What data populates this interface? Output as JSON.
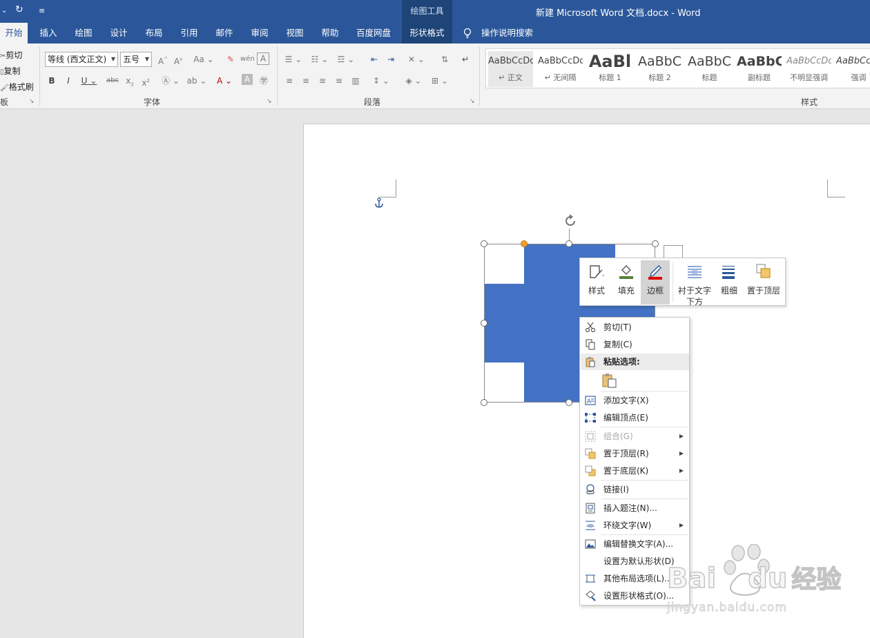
{
  "titlebar": {
    "context_group": "绘图工具",
    "document_title": "新建 Microsoft Word 文档.docx  -  Word"
  },
  "tabs": [
    "开始",
    "插入",
    "绘图",
    "设计",
    "布局",
    "引用",
    "邮件",
    "审阅",
    "视图",
    "帮助",
    "百度网盘",
    "形状格式"
  ],
  "search": {
    "label": "操作说明搜索"
  },
  "clipboard": {
    "cut": "剪切",
    "copy": "复制",
    "format_painter": "格式刷",
    "group_label": "板"
  },
  "font": {
    "name": "等线 (西文正文)",
    "size": "五号",
    "group_label": "字体"
  },
  "paragraph": {
    "group_label": "段落"
  },
  "styles": {
    "group_label": "样式",
    "items": [
      {
        "sample": "AaBbCcDd",
        "name": "↵ 正文"
      },
      {
        "sample": "AaBbCcDd",
        "name": "↵ 无间隔"
      },
      {
        "sample": "AaBl",
        "name": "标题 1"
      },
      {
        "sample": "AaBbC",
        "name": "标题 2"
      },
      {
        "sample": "AaBbC",
        "name": "标题"
      },
      {
        "sample": "AaBbC",
        "name": "副标题"
      },
      {
        "sample": "AaBbCcDd",
        "name": "不明显强调"
      },
      {
        "sample": "AaBbCcDd",
        "name": "强调"
      }
    ]
  },
  "mini_toolbar": {
    "buttons": [
      {
        "label": "样式",
        "icon": "shape-style-icon"
      },
      {
        "label": "填充",
        "icon": "fill-bucket-icon"
      },
      {
        "label": "边框",
        "icon": "outline-pen-icon"
      },
      {
        "label": "衬于文字\n下方",
        "icon": "behind-text-icon"
      },
      {
        "label": "粗细",
        "icon": "line-weight-icon"
      },
      {
        "label": "置于顶层",
        "icon": "bring-to-front-icon"
      }
    ]
  },
  "context_menu": {
    "items": [
      {
        "label": "剪切(T)",
        "icon": "scissors-icon"
      },
      {
        "label": "复制(C)",
        "icon": "copy-icon"
      },
      {
        "label": "粘贴选项:",
        "icon": "paste-icon"
      },
      {
        "label": "添加文字(X)",
        "icon": "add-text-icon"
      },
      {
        "label": "编辑顶点(E)",
        "icon": "edit-points-icon"
      },
      {
        "label": "组合(G)",
        "icon": "group-icon"
      },
      {
        "label": "置于顶层(R)",
        "icon": "bring-to-front-icon"
      },
      {
        "label": "置于底层(K)",
        "icon": "send-to-back-icon"
      },
      {
        "label": "链接(I)",
        "icon": "link-icon"
      },
      {
        "label": "插入题注(N)...",
        "icon": "caption-icon"
      },
      {
        "label": "环绕文字(W)",
        "icon": "wrap-text-icon"
      },
      {
        "label": "编辑替换文字(A)...",
        "icon": "alt-text-icon"
      },
      {
        "label": "设置为默认形状(D)",
        "icon": ""
      },
      {
        "label": "其他布局选项(L)...",
        "icon": "layout-options-icon"
      },
      {
        "label": "设置形状格式(O)...",
        "icon": "format-shape-icon"
      }
    ]
  },
  "watermark": {
    "brand": "Bai",
    "brand_tail": "du",
    "site_cn": "经验",
    "url": "jingyan.baidu.com"
  },
  "colors": {
    "word_blue": "#2b579a",
    "shape_fill": "#4472c4",
    "handle_accent": "#f0a030"
  }
}
